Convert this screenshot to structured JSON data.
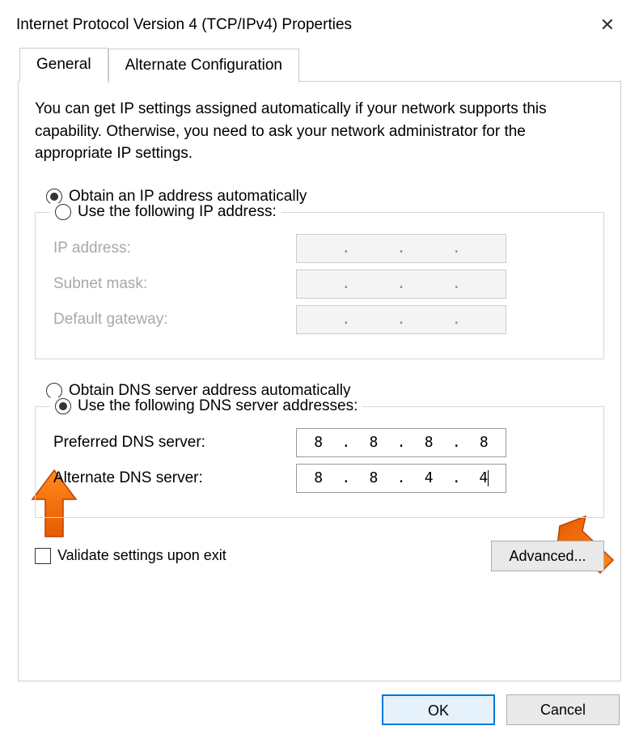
{
  "window": {
    "title": "Internet Protocol Version 4 (TCP/IPv4) Properties"
  },
  "tabs": {
    "general": "General",
    "alternate": "Alternate Configuration"
  },
  "description": "You can get IP settings assigned automatically if your network supports this capability. Otherwise, you need to ask your network administrator for the appropriate IP settings.",
  "ip": {
    "auto_label": "Obtain an IP address automatically",
    "manual_label": "Use the following IP address:",
    "auto_selected": true,
    "ip_address_label": "IP address:",
    "subnet_label": "Subnet mask:",
    "gateway_label": "Default gateway:",
    "ip_address_value": [
      "",
      "",
      "",
      ""
    ],
    "subnet_value": [
      "",
      "",
      "",
      ""
    ],
    "gateway_value": [
      "",
      "",
      "",
      ""
    ]
  },
  "dns": {
    "auto_label": "Obtain DNS server address automatically",
    "manual_label": "Use the following DNS server addresses:",
    "manual_selected": true,
    "preferred_label": "Preferred DNS server:",
    "alternate_label": "Alternate DNS server:",
    "preferred_value": [
      "8",
      "8",
      "8",
      "8"
    ],
    "alternate_value": [
      "8",
      "8",
      "4",
      "4"
    ]
  },
  "validate_label": "Validate settings upon exit",
  "advanced_label": "Advanced...",
  "ok_label": "OK",
  "cancel_label": "Cancel"
}
